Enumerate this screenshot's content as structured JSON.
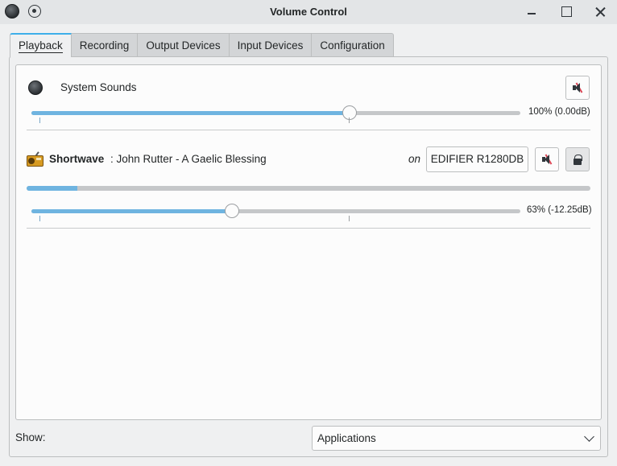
{
  "window": {
    "title": "Volume Control"
  },
  "tabs": [
    {
      "label": "Playback",
      "active": true
    },
    {
      "label": "Recording",
      "active": false
    },
    {
      "label": "Output Devices",
      "active": false
    },
    {
      "label": "Input Devices",
      "active": false
    },
    {
      "label": "Configuration",
      "active": false
    }
  ],
  "system_sounds": {
    "label": "System Sounds",
    "volume_fraction": 0.65,
    "volume_text": "100% (0.00dB)",
    "muted": false
  },
  "stream": {
    "app_name": "Shortwave",
    "media_title": ": John Rutter - A Gaelic Blessing",
    "on_label": "on",
    "device": "EDIFIER R1280DB",
    "peak_level": 0.09,
    "volume_fraction": 0.41,
    "volume_text": "63% (-12.25dB)",
    "muted": false,
    "locked": true
  },
  "footer": {
    "show_label": "Show:",
    "show_value": "Applications"
  },
  "colors": {
    "accent": "#3daee9",
    "slider_fill": "#6fb4e0",
    "mute_slash": "#da4453"
  },
  "icons": {
    "app": "audio-volume-icon",
    "pin": "keep-above-icon",
    "stream": "radio-icon",
    "mute": "speaker-muted-icon",
    "lock": "lock-icon"
  }
}
